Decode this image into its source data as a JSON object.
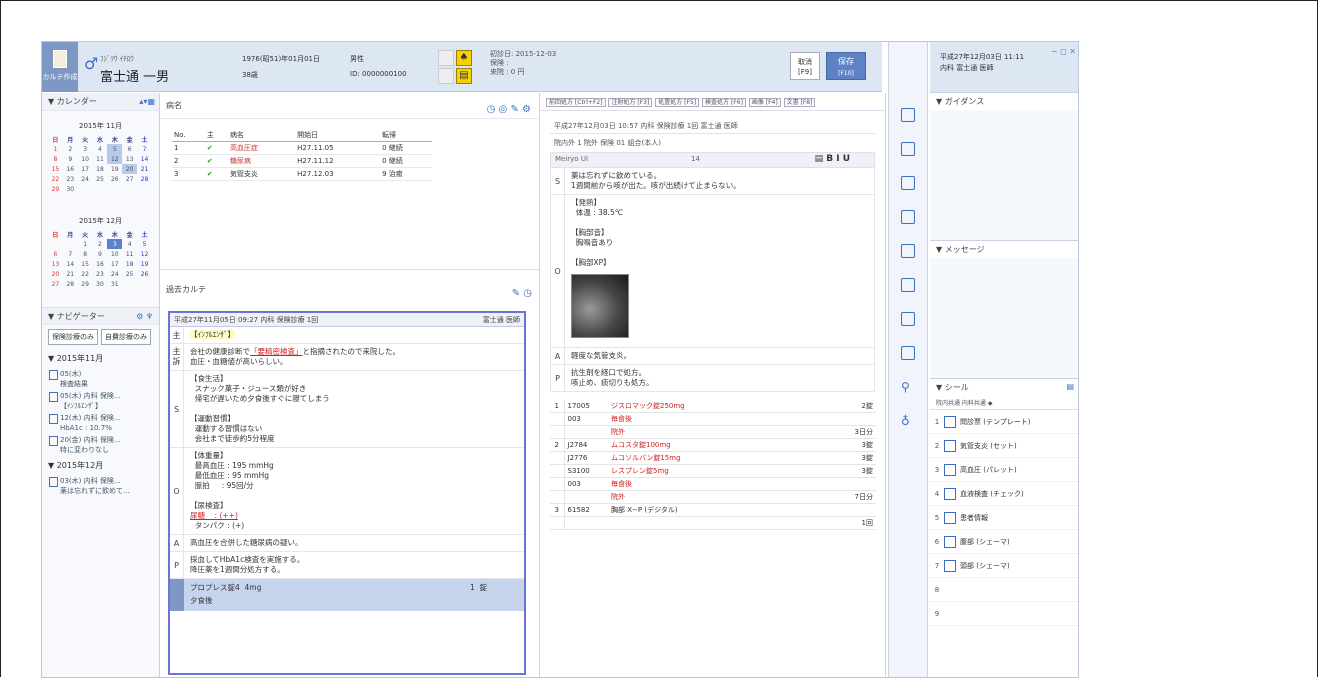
{
  "header": {
    "karte_label": "カルテ作成",
    "patient_kana": "ﾌｼﾞﾂｳ ｲﾁﾛｳ",
    "patient_name": "富士通 一男",
    "birth": "1976(昭51)年01月01日",
    "age": "38歳",
    "sex": "男性",
    "id": "ID: 0000000100",
    "visit": "初診日: 2015-12-03\n保険 : \n来院 : 0 円",
    "cancel_label": "取消\n[F9]",
    "save_label": "保存",
    "save_key": "[F10]"
  },
  "calendar": {
    "header": "▼ カレンダー",
    "weekdays": [
      "日",
      "月",
      "火",
      "水",
      "木",
      "金",
      "土"
    ],
    "nov_title": "2015年 11月",
    "dec_title": "2015年 12月"
  },
  "navigator": {
    "header": "▼ ナビゲーター",
    "tab1": "保険診療のみ",
    "tab2": "自費診療のみ",
    "month1": "▼ 2015年11月",
    "month2": "▼ 2015年12月",
    "items": [
      {
        "l1": "05(木)",
        "l2": "検査結果"
      },
      {
        "l1": "05(木) 内科 保険...",
        "l2": "【ｲﾝﾌﾙｴﾝｻﾞ】"
      },
      {
        "l1": "12(木) 内科 保険...",
        "l2": "HbA1c : 10.7%"
      },
      {
        "l1": "20(金) 内科 保険...",
        "l2": "特に変わりなし"
      },
      {
        "l1": "03(木) 内科 保険...",
        "l2": "薬は忘れずに飲めて..."
      }
    ]
  },
  "diseases": {
    "header": "病名",
    "cols": [
      "No.",
      "主",
      "病名",
      "開始日",
      "転帰"
    ],
    "rows": [
      {
        "no": "1",
        "name": "高血圧症",
        "date": "H27.11.05",
        "status": "0 継続"
      },
      {
        "no": "2",
        "name": "糖尿病",
        "date": "H27.11.12",
        "status": "0 継続"
      },
      {
        "no": "3",
        "name": "気管支炎",
        "date": "H27.12.03",
        "status": "9 治癒"
      }
    ]
  },
  "past_karte": {
    "header": "過去カルテ",
    "entry_header": "平成27年11月05日 09:27 内科 保険診療 1回",
    "doctor": "富士通 医師",
    "label_main": "主",
    "label_kou": "主\n訴",
    "label_s": "S",
    "label_o": "O",
    "label_a": "A",
    "label_p": "P",
    "main": "【ｲﾝﾌﾙｴﾝｻﾞ】",
    "complaint_1": "会社の健康診断で",
    "complaint_hl": "「要精密検査」",
    "complaint_2": "と指摘されたので来院した。",
    "complaint_3": "血圧・血糖値が高いらしい。",
    "s_text": "【食生活】\n  スナック菓子・ジュース類が好き\n  帰宅が遅いため夕食後すぐに寝てしまう\n\n【運動習慣】\n  運動する習慣はない\n  会社まで徒歩約5分程度",
    "o_text": "【体重量】\n  最高血圧 : 195 mmHg\n  最低血圧 : 95 mmHg\n  脈拍     : 95回/分\n\n【尿検査】",
    "o_sugar": "尿糖    : (++)",
    "o_protein": "  タンパク : (+)",
    "a_text": "高血圧を合併した糖尿病の疑い。",
    "p_text": "採血してHbA1c検査を実施する。\n降圧薬を1週間分処方する。",
    "rx_1": "プロプレス錠4  4mg",
    "rx_2": "夕食後",
    "rx_qty": "1  錠"
  },
  "current": {
    "tabs": [
      "前回",
      "前回処方 [Ctrl+F2]",
      "注射処方 [F3]",
      "処置処方 [F5]",
      "検査処方 [F6]",
      "画像 [F4]",
      "文書 [F8]"
    ],
    "tabs_prefix": "前回",
    "entry_header": "平成27年12月03日 10:57 内科 保険診療 1回 富士通 医師",
    "sub": "院内外 1 院外  保険 01 組合(本人)",
    "font": "Meiryo UI",
    "size": "14",
    "s_text": "薬は忘れずに飲めている。\n1週間前から咳が出た。咳が出続けて止まらない。",
    "o_text": "【発熱】\n  体温 : 38.5℃\n\n【胸部音】\n  胸鳴音あり\n\n【胸部XP】",
    "a_text": "軽度な気管支炎。",
    "p_text": "抗生剤を経口で処方。\n咳止め、痰切りも処方。",
    "orders": [
      {
        "n": "1",
        "code": "17005",
        "name": "ジスロマック錠250mg",
        "qty": "2錠",
        "red": true
      },
      {
        "n": "",
        "code": "003",
        "name": "毎食後",
        "qty": "",
        "red": true
      },
      {
        "n": "",
        "code": "",
        "name": "院外",
        "qty": "3日分",
        "red": true
      },
      {
        "n": "2",
        "code": "J2784",
        "name": "ムコスタ錠100mg",
        "qty": "3錠",
        "red": true
      },
      {
        "n": "",
        "code": "J2776",
        "name": "ムコソルバン錠15mg",
        "qty": "3錠",
        "red": true
      },
      {
        "n": "",
        "code": "S3100",
        "name": "レスプレン錠5mg",
        "qty": "3錠",
        "red": true
      },
      {
        "n": "",
        "code": "003",
        "name": "毎食後",
        "qty": "",
        "red": true
      },
      {
        "n": "",
        "code": "",
        "name": "院外",
        "qty": "7日分",
        "red": true
      },
      {
        "n": "3",
        "code": "61582",
        "name": "胸部 X−P (デジタル)",
        "qty": "",
        "red": false
      },
      {
        "n": "",
        "code": "",
        "name": "",
        "qty": "1回",
        "red": false
      }
    ]
  },
  "right": {
    "datetime": "平成27年12月03日 11:11",
    "dept": "内科    富士通 医師",
    "guidance": "▼ ガイダンス",
    "message": "▼ メッセージ",
    "seal": "▼ シール",
    "seal_tab": "院内共通  内科共通  ◆",
    "seals": [
      {
        "n": "1",
        "label": "問診票 (テンプレート)"
      },
      {
        "n": "2",
        "label": "気管支炎 (セット)"
      },
      {
        "n": "3",
        "label": "高血圧 (パレット)"
      },
      {
        "n": "4",
        "label": "血液検査 (チェック)"
      },
      {
        "n": "5",
        "label": "患者情報"
      },
      {
        "n": "6",
        "label": "腹部 (シェーマ)"
      },
      {
        "n": "7",
        "label": "頭部 (シェーマ)"
      }
    ]
  }
}
